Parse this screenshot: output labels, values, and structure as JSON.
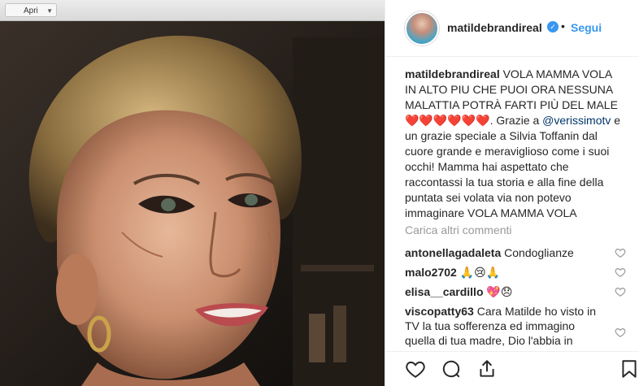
{
  "photo": {
    "toolbar_label": "Apri"
  },
  "header": {
    "username": "matildebrandireal",
    "dot": "•",
    "follow_label": "Segui"
  },
  "caption": {
    "username": "matildebrandireal",
    "text_part1": "VOLA MAMMA VOLA IN ALTO PIU CHE PUOI ORA NESSUNA MALATTIA POTRÀ FARTI PIÙ DEL MALE ❤️❤️❤️❤️❤️❤️. Grazie a ",
    "mention": "@verissimotv",
    "text_part2": " e un grazie speciale a Silvia Toffanin dal cuore grande e meraviglioso come i suoi occhi! Mamma hai aspettato che raccontassi la tua storia e alla fine della puntata sei volata via non potevo immaginare VOLA MAMMA VOLA"
  },
  "load_more": "Carica altri commenti",
  "comments": [
    {
      "username": "antonellagadaleta",
      "text": "Condoglianze"
    },
    {
      "username": "malo2702",
      "text": "🙏😢🙏"
    },
    {
      "username": "elisa__cardillo",
      "text": "💖😞"
    },
    {
      "username": "viscopatty63",
      "text": "Cara Matilde ho visto in TV la tua sofferenza ed immagino quella di tua madre, Dio l'abbia in"
    }
  ],
  "icons": {
    "like": "heart-icon",
    "comment": "comment-icon",
    "share": "share-icon",
    "save": "bookmark-icon",
    "verified": "verified-badge-icon"
  },
  "colors": {
    "link_blue": "#3897f0",
    "mention_blue": "#003569",
    "muted": "#999999",
    "text": "#262626"
  }
}
